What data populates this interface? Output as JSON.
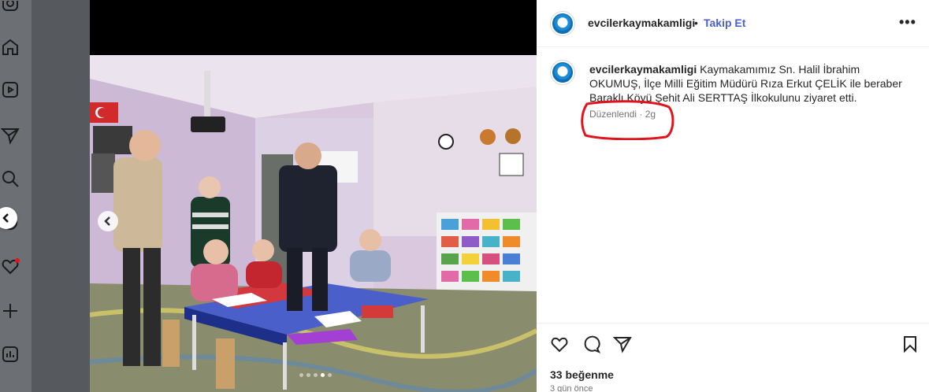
{
  "sidebar": {
    "icons": [
      "instagram-icon",
      "home-icon",
      "reels-icon",
      "direct-icon",
      "search-icon",
      "threads-icon",
      "notifications-icon",
      "create-icon",
      "dashboard-icon"
    ]
  },
  "post": {
    "username": "evcilerkaymakamligi",
    "separator": "•",
    "follow_label": "Takip Et",
    "more_label": "•••",
    "caption_username": "evcilerkaymakamligi",
    "caption_text": " Kaymakamımız Sn. Halil İbrahim OKUMUŞ, İlçe Milli Eğitim Müdürü Rıza Erkut ÇELİK ile beraber Baraklı Köyü Şehit Ali SERTTAŞ İlkokulunu ziyaret etti.",
    "edited_label": "Düzenlendi · 2g",
    "likes": "33 beğenme",
    "posted_ago": "3 gün önce",
    "annotation_color": "#e0141e"
  },
  "photo": {
    "alt_scene": "classroom",
    "carousel": {
      "count": 5,
      "active": 4
    }
  }
}
